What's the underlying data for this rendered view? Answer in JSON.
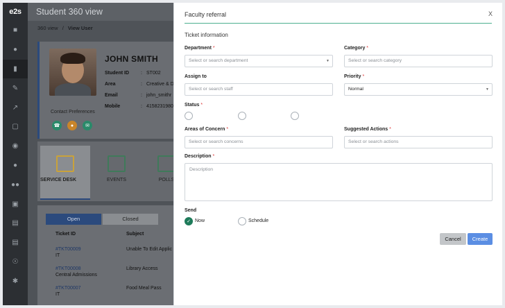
{
  "nav": {
    "logo": "e2s",
    "icons": [
      "home-icon",
      "user-icon",
      "phone-icon",
      "edit-icon",
      "chart-icon",
      "calendar-icon",
      "settings-icon",
      "person-icon",
      "group-icon",
      "briefcase-icon",
      "document-icon",
      "file-icon",
      "globe-icon",
      "gear-icon"
    ]
  },
  "page": {
    "title": "Student 360 view",
    "breadcrumb": {
      "root": "360 view",
      "sep": "/",
      "current": "View User"
    }
  },
  "profile": {
    "name": "JOHN SMITH",
    "fields": [
      {
        "key": "Student ID",
        "value": "ST002"
      },
      {
        "key": "Area",
        "value": "Creative & Di"
      },
      {
        "key": "Email",
        "value": "john_smithr"
      },
      {
        "key": "Mobile",
        "value": "4158231980"
      }
    ],
    "contact_preferences_label": "Contact Preferences",
    "contact_buttons": [
      "phone-icon",
      "chat-icon",
      "email-icon"
    ]
  },
  "tiles": [
    {
      "label": "SERVICE DESK",
      "icon": "notepad-icon"
    },
    {
      "label": "EVENTS",
      "icon": "calendar-grid-icon"
    },
    {
      "label": "POLLS",
      "icon": "list-icon"
    }
  ],
  "tickets": {
    "tabs": {
      "open": "Open",
      "closed": "Closed"
    },
    "headers": {
      "id": "Ticket ID",
      "subject": "Subject"
    },
    "rows": [
      {
        "id": "#TKT00009",
        "dept": "IT",
        "subject": "Unable To Edit Applic"
      },
      {
        "id": "#TKT00008",
        "dept": "Central Admissions",
        "subject": "Library Access"
      },
      {
        "id": "#TKT00007",
        "dept": "IT",
        "subject": "Food Meal Pass"
      }
    ]
  },
  "modal": {
    "title": "Faculty referral",
    "close": "X",
    "section": "Ticket information",
    "department": {
      "label": "Department",
      "required": "*",
      "placeholder": "Select or search department"
    },
    "category": {
      "label": "Category",
      "required": "*",
      "placeholder": "Select or search category"
    },
    "assign_to": {
      "label": "Assign to",
      "placeholder": "Select or search staff"
    },
    "priority": {
      "label": "Priority",
      "required": "*",
      "value": "Normal"
    },
    "status": {
      "label": "Status",
      "required": "*"
    },
    "areas": {
      "label": "Areas of Concern",
      "required": "*",
      "placeholder": "Select or search concerns"
    },
    "actions": {
      "label": "Suggested Actions",
      "required": "*",
      "placeholder": "Select or search actions"
    },
    "description": {
      "label": "Description",
      "required": "*",
      "placeholder": "Description"
    },
    "send": {
      "label": "Send",
      "now": "Now",
      "schedule": "Schedule"
    },
    "buttons": {
      "cancel": "Cancel",
      "create": "Create"
    }
  },
  "colors": {
    "accent_green": "#1e7b5a",
    "rule_green": "#4caf8e",
    "primary_blue": "#5b8ee3",
    "nav_bg": "#2c2f33"
  }
}
